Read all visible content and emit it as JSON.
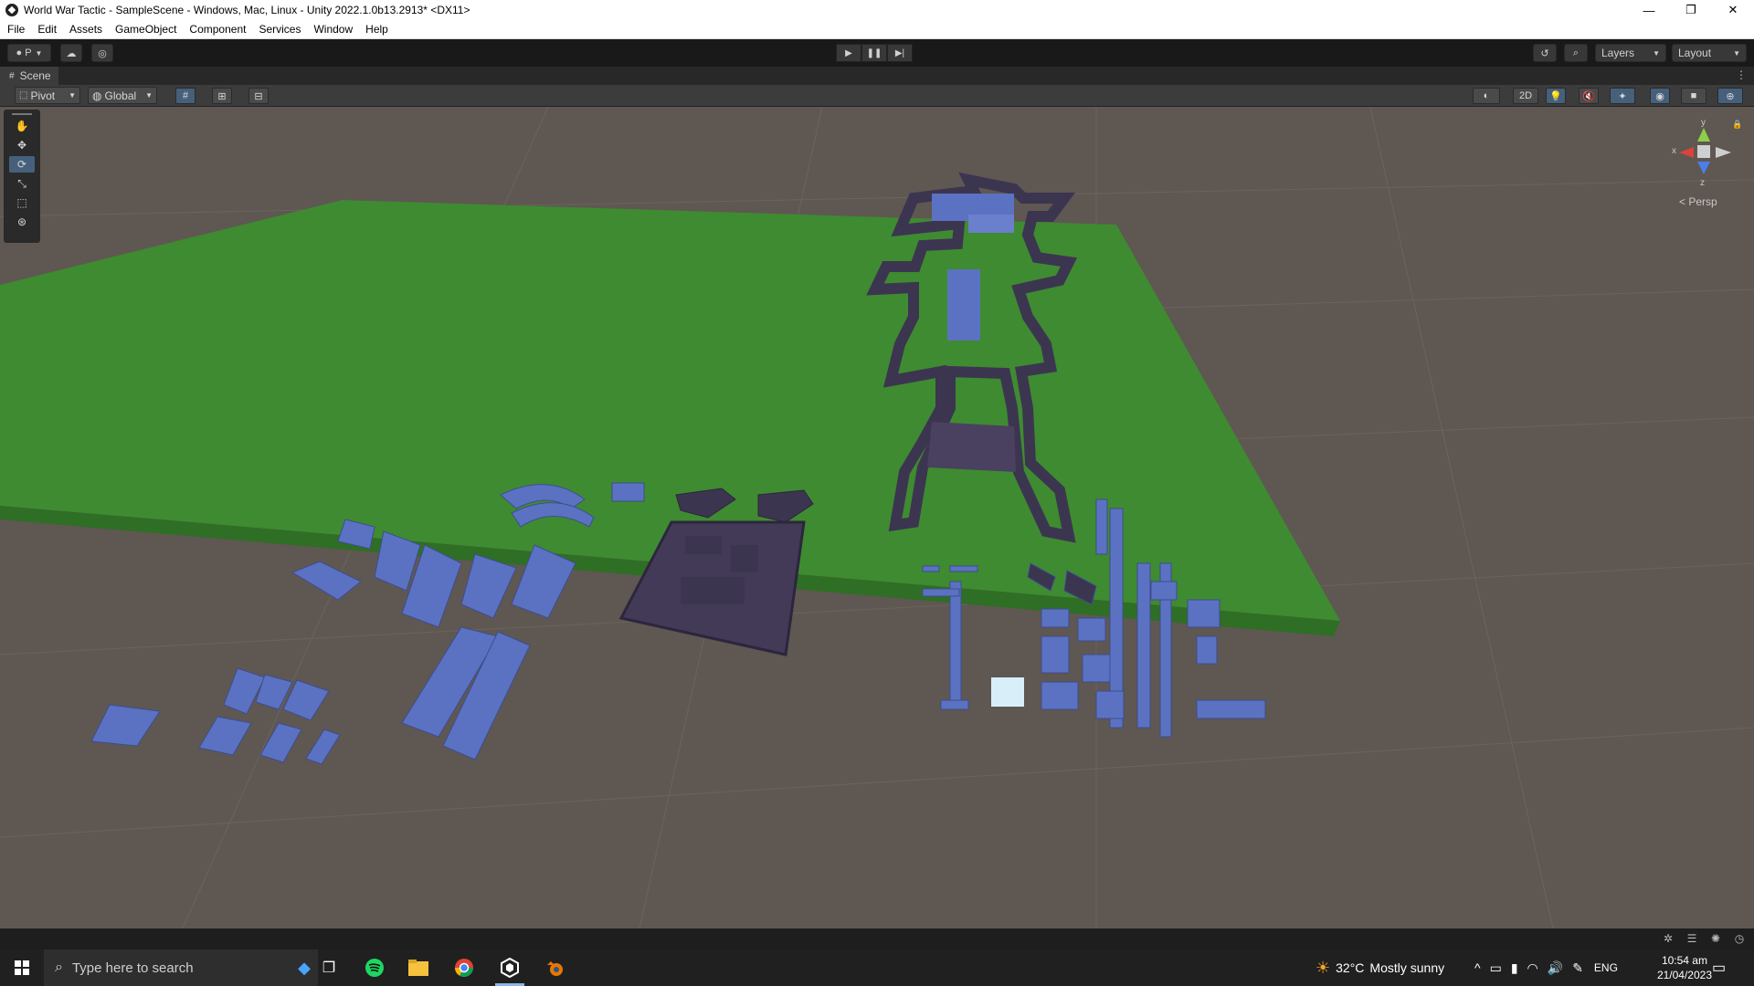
{
  "window": {
    "title": "World War Tactic - SampleScene - Windows, Mac, Linux - Unity 2022.1.0b13.2913* <DX11>",
    "minimize": "—",
    "restore": "❐",
    "close": "✕"
  },
  "menu": [
    "File",
    "Edit",
    "Assets",
    "GameObject",
    "Component",
    "Services",
    "Window",
    "Help"
  ],
  "toolbar": {
    "account_label": "P",
    "layers_label": "Layers",
    "layout_label": "Layout"
  },
  "scene_tab": {
    "label": "Scene"
  },
  "scene_toolbar": {
    "pivot_label": "Pivot",
    "global_label": "Global",
    "mode_2d_label": "2D"
  },
  "gizmo": {
    "y_label": "y",
    "x_label": "x",
    "z_label": "z",
    "persp_label": "Persp"
  },
  "taskbar": {
    "search_placeholder": "Type here to search",
    "weather_temp": "32°C",
    "weather_text": "Mostly sunny",
    "language": "ENG",
    "time": "10:54 am",
    "date": "21/04/2023"
  },
  "colors": {
    "ground": "#5f5752",
    "terrain": "#3e8a30",
    "buildings": "#5b72c2",
    "dark_structures": "#3c3550"
  }
}
